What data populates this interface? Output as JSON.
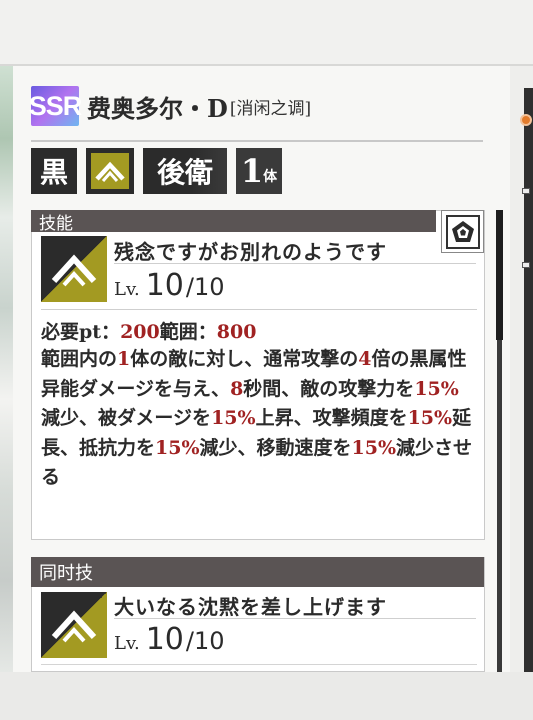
{
  "character": {
    "rarity": "SSR",
    "name": "费奥多尔・D",
    "subtitle": "[消闲之调]",
    "colors": {
      "rarity_gradient": [
        "#6a5be0",
        "#b173ef",
        "#6fb6f0"
      ]
    }
  },
  "tags": {
    "attribute": "黒",
    "type_icon": "chevron-up-icon",
    "position": "後衛",
    "count_number": "1",
    "count_unit": "体"
  },
  "skill_section": {
    "title": "技能",
    "filter_icon": "pentagon-icon",
    "skill": {
      "icon": "chevron-up-icon",
      "name": "残念ですがお別れのようです",
      "level_label": "Lv.",
      "level_current": "10",
      "level_max": "/10",
      "required_pt_label": "必要pt：",
      "required_pt_value": "200",
      "range_label": "範囲：",
      "range_value": "800",
      "description_parts": [
        {
          "t": "範囲内の",
          "h": false
        },
        {
          "t": "1",
          "h": true
        },
        {
          "t": "体の敵に対し、通常攻撃の",
          "h": false
        },
        {
          "t": "4",
          "h": true
        },
        {
          "t": "倍の黒属性异能ダメージを与え、",
          "h": false
        },
        {
          "t": "8",
          "h": true
        },
        {
          "t": "秒間、敵の攻撃力を",
          "h": false
        },
        {
          "t": "15%",
          "h": true
        },
        {
          "t": "減少、被ダメージを",
          "h": false
        },
        {
          "t": "15%",
          "h": true
        },
        {
          "t": "上昇、攻撃頻度を",
          "h": false
        },
        {
          "t": "15%",
          "h": true
        },
        {
          "t": "延長、抵抗力を",
          "h": false
        },
        {
          "t": "15%",
          "h": true
        },
        {
          "t": "減少、移動速度を",
          "h": false
        },
        {
          "t": "15%",
          "h": true
        },
        {
          "t": "減少させる",
          "h": false
        }
      ]
    }
  },
  "coop_section": {
    "title": "同时技",
    "skill": {
      "icon": "chevron-up-icon",
      "name": "大いなる沈黙を差し上げます",
      "level_label": "Lv.",
      "level_current": "10",
      "level_max": "/10"
    }
  },
  "colors": {
    "highlight": "#a02222",
    "section_bar": "#5a5454",
    "type_gold": "#a39a22",
    "accent_orange": "#e27b2b"
  }
}
